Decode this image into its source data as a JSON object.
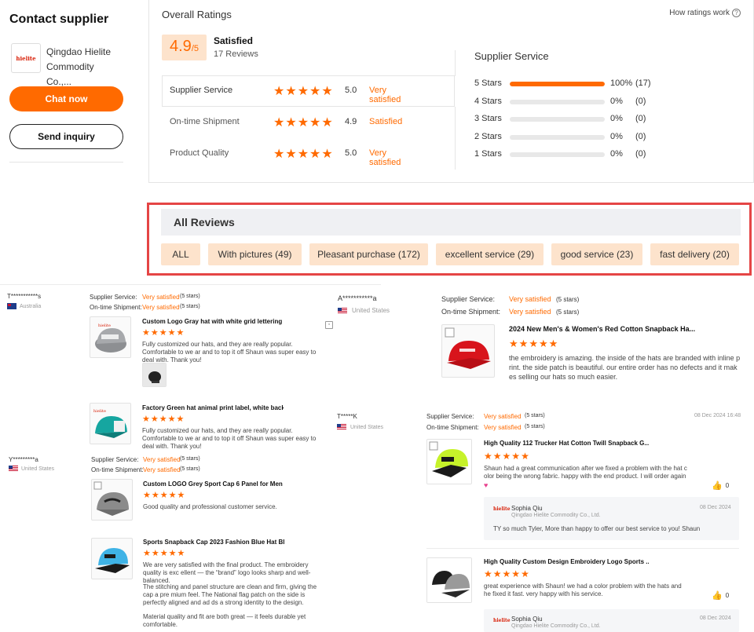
{
  "supplier": {
    "title": "Contact supplier",
    "company": "Qingdao Hielite Commodity Co.,...",
    "logo_text": "hielite",
    "chat_label": "Chat now",
    "inquiry_label": "Send inquiry"
  },
  "ratings": {
    "heading": "Overall Ratings",
    "how_link": "How ratings work",
    "score": "4.9",
    "score_max": "/5",
    "overall_label": "Satisfied",
    "reviews_count": "17 Reviews",
    "categories": [
      {
        "label": "Supplier Service",
        "value": "5.0",
        "rating": "Very satisfied",
        "stars": 5
      },
      {
        "label": "On-time Shipment",
        "value": "4.9",
        "rating": "Satisfied",
        "stars": 5
      },
      {
        "label": "Product Quality",
        "value": "5.0",
        "rating": "Very satisfied",
        "stars": 5
      }
    ],
    "distribution_title": "Supplier Service",
    "distribution": [
      {
        "label": "5 Stars",
        "percent": "100%",
        "count": "(17)",
        "fill": 1.0
      },
      {
        "label": "4 Stars",
        "percent": "0%",
        "count": "(0)",
        "fill": 0
      },
      {
        "label": "3 Stars",
        "percent": "0%",
        "count": "(0)",
        "fill": 0
      },
      {
        "label": "2 Stars",
        "percent": "0%",
        "count": "(0)",
        "fill": 0
      },
      {
        "label": "1 Stars",
        "percent": "0%",
        "count": "(0)",
        "fill": 0
      }
    ]
  },
  "all_reviews": {
    "heading": "All Reviews",
    "filters": [
      "ALL",
      "With pictures (49)",
      "Pleasant purchase (172)",
      "excellent service (29)",
      "good service (23)",
      "fast delivery (20)"
    ]
  },
  "labels": {
    "supplier_service": "Supplier Service:",
    "ontime_shipment": "On-time Shipment:",
    "five_stars": "(5 stars)",
    "very_satisfied": "Very satisfied"
  },
  "reviews": [
    {
      "user": "T***********s",
      "country": "Australia",
      "products": [
        {
          "title": "Custom Logo Gray hat with white grid lettering embroi...",
          "text": "Fully customized our hats, and they are really popular. Comfortable to we ar and to top it off Shaun was super easy to deal with. Thank you!"
        },
        {
          "title": "Factory Green hat animal print label, white back net s...",
          "text": "Fully customized our hats, and they are really popular. Comfortable to we ar and to top it off Shaun was super easy to deal with. Thank you!"
        }
      ]
    },
    {
      "user": "Y*********a",
      "country": "United States",
      "products": [
        {
          "title": "Custom LOGO Grey Sport Cap 6 Panel for Men and W...",
          "text": "Good quality and professional customer service."
        },
        {
          "title": "Sports Snapback Cap 2023 Fashion Blue Hat Black S...",
          "text1": "We are very satisfied with the final product. The embroidery quality is exc ellent — the “brand” logo looks sharp and well-balanced.",
          "text2": "The stitching and panel structure are clean and firm, giving the cap a pre mium feel. The National flag patch on the side is perfectly aligned and ad ds a strong identity to the design.",
          "text3": "Material quality and fit are both great — it feels durable yet comfortable."
        }
      ]
    },
    {
      "user": "A***********a",
      "country": "United States",
      "product": {
        "title": "2024 New Men's & Women's Red Cotton Snapback Ha...",
        "text": "the embroidery is amazing. the inside of the hats are branded with inline p rint. the side patch is beautiful. our entire order has no defects and it mak es selling our hats so much easier."
      }
    },
    {
      "user": "T*****K",
      "country": "United States",
      "date": "08 Dec 2024 16:48",
      "products": [
        {
          "title": "High Quality 112 Trucker Hat Cotton Twill Snapback G...",
          "text": "Shaun had a great communication after we fixed a problem with the hat c olor being the wrong fabric. happy with the end product. I will order again",
          "likes": "0",
          "reply": {
            "name": "Sophia Qiu",
            "company": "Qingdao Hielite Commodity Co., Ltd.",
            "date": "08 Dec 2024",
            "text": "TY so much Tyler, More than happy to offer our best service to you!  Shaun"
          }
        },
        {
          "title": "High Quality Custom Design Embroidery Logo Sports ...",
          "text": "great experience with Shaun! we had a color problem with the hats and he fixed it fast. very happy with his service.",
          "likes": "0",
          "reply": {
            "name": "Sophia Qiu",
            "company": "Qingdao Hielite Commodity Co., Ltd.",
            "date": "08 Dec 2024"
          }
        }
      ]
    }
  ],
  "colors": {
    "accent": "#ff6a00",
    "chip_bg": "#fde3cc",
    "highlight_border": "#e54545"
  }
}
